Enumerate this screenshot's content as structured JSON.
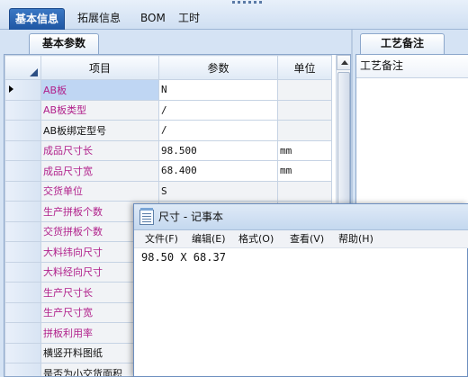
{
  "main_tabs": [
    {
      "label": "基本信息",
      "active": true
    },
    {
      "label": "拓展信息",
      "active": false
    },
    {
      "label": "BOM",
      "active": false
    },
    {
      "label": "工时",
      "active": false
    }
  ],
  "left_panel": {
    "tab_label": "基本参数",
    "columns": [
      "项目",
      "参数",
      "单位"
    ],
    "rows": [
      {
        "label": "AB板",
        "value": "N",
        "unit": "",
        "label_color": "magenta",
        "current": true
      },
      {
        "label": "AB板类型",
        "value": "/",
        "unit": "",
        "label_color": "magenta"
      },
      {
        "label": "AB板绑定型号",
        "value": "/",
        "unit": "",
        "label_color": "black"
      },
      {
        "label": "成品尺寸长",
        "value": "98.500",
        "unit": "mm",
        "label_color": "magenta"
      },
      {
        "label": "成品尺寸宽",
        "value": "68.400",
        "unit": "mm",
        "label_color": "magenta"
      },
      {
        "label": "交货单位",
        "value": "S",
        "unit": "",
        "label_color": "magenta"
      },
      {
        "label": "生产拼板个数",
        "value": "",
        "unit": "",
        "label_color": "magenta"
      },
      {
        "label": "交货拼板个数",
        "value": "",
        "unit": "",
        "label_color": "magenta"
      },
      {
        "label": "大料纬向尺寸",
        "value": "",
        "unit": "",
        "label_color": "magenta"
      },
      {
        "label": "大料经向尺寸",
        "value": "",
        "unit": "",
        "label_color": "magenta"
      },
      {
        "label": "生产尺寸长",
        "value": "",
        "unit": "",
        "label_color": "magenta"
      },
      {
        "label": "生产尺寸宽",
        "value": "",
        "unit": "",
        "label_color": "magenta"
      },
      {
        "label": "拼板利用率",
        "value": "",
        "unit": "",
        "label_color": "magenta"
      },
      {
        "label": "横竖开料图纸",
        "value": "",
        "unit": "",
        "label_color": "black"
      },
      {
        "label": "是否为小交货面积",
        "value": "",
        "unit": "",
        "label_color": "black"
      }
    ]
  },
  "right_panel": {
    "tab_label": "工艺备注",
    "header": "工艺备注"
  },
  "notepad": {
    "title": "尺寸 - 记事本",
    "menus": [
      "文件(F)",
      "编辑(E)",
      "格式(O)",
      "查看(V)",
      "帮助(H)"
    ],
    "content": "98.50 X 68.37"
  },
  "colors": {
    "label_magenta": "#b1208b",
    "active_tab": "#1e56a3",
    "panel_bg": "#d5e3f4"
  }
}
